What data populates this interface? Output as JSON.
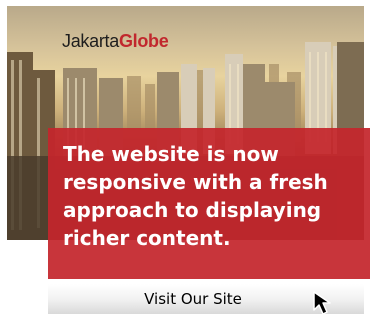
{
  "logo": {
    "part1": "Jakarta",
    "part2": "Globe"
  },
  "message": "The website is now responsive with a fresh approach to displaying richer content.",
  "cta": {
    "label": "Visit Our Site"
  },
  "icons": {
    "cursor": "mouse-pointer-icon"
  },
  "colors": {
    "brand_red": "#c1272d",
    "panel_red": "#c4262c",
    "logo_dark": "#1e1e1e"
  }
}
